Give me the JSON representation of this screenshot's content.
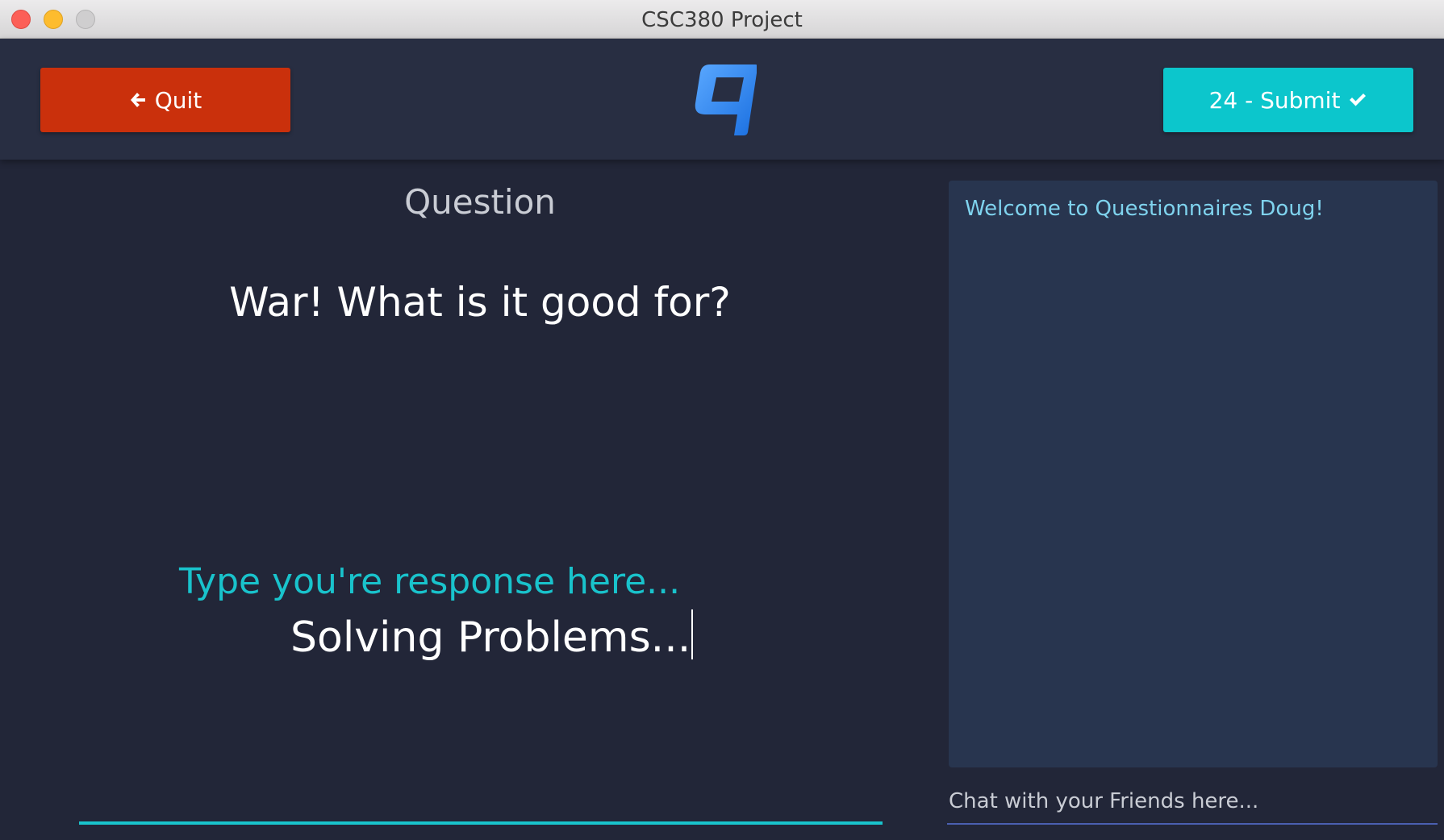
{
  "window": {
    "title": "CSC380 Project"
  },
  "header": {
    "quit_label": "Quit",
    "submit_label": "24 - Submit",
    "logo": "q-logo"
  },
  "question": {
    "label": "Question",
    "text": "War! What is it good for?"
  },
  "response": {
    "placeholder": "Type you're response here...",
    "value": "Solving Problems..."
  },
  "chat": {
    "messages": [
      "Welcome to Questionnaires Doug!"
    ],
    "placeholder": "Chat with your Friends here..."
  },
  "colors": {
    "quit": "#ca300c",
    "submit": "#0cc6cc",
    "accent": "#19c3cc",
    "background": "#222638",
    "header": "#282e42",
    "chat_panel": "#28354f"
  },
  "icons": {
    "quit": "arrow-left-icon",
    "submit": "check-icon"
  }
}
